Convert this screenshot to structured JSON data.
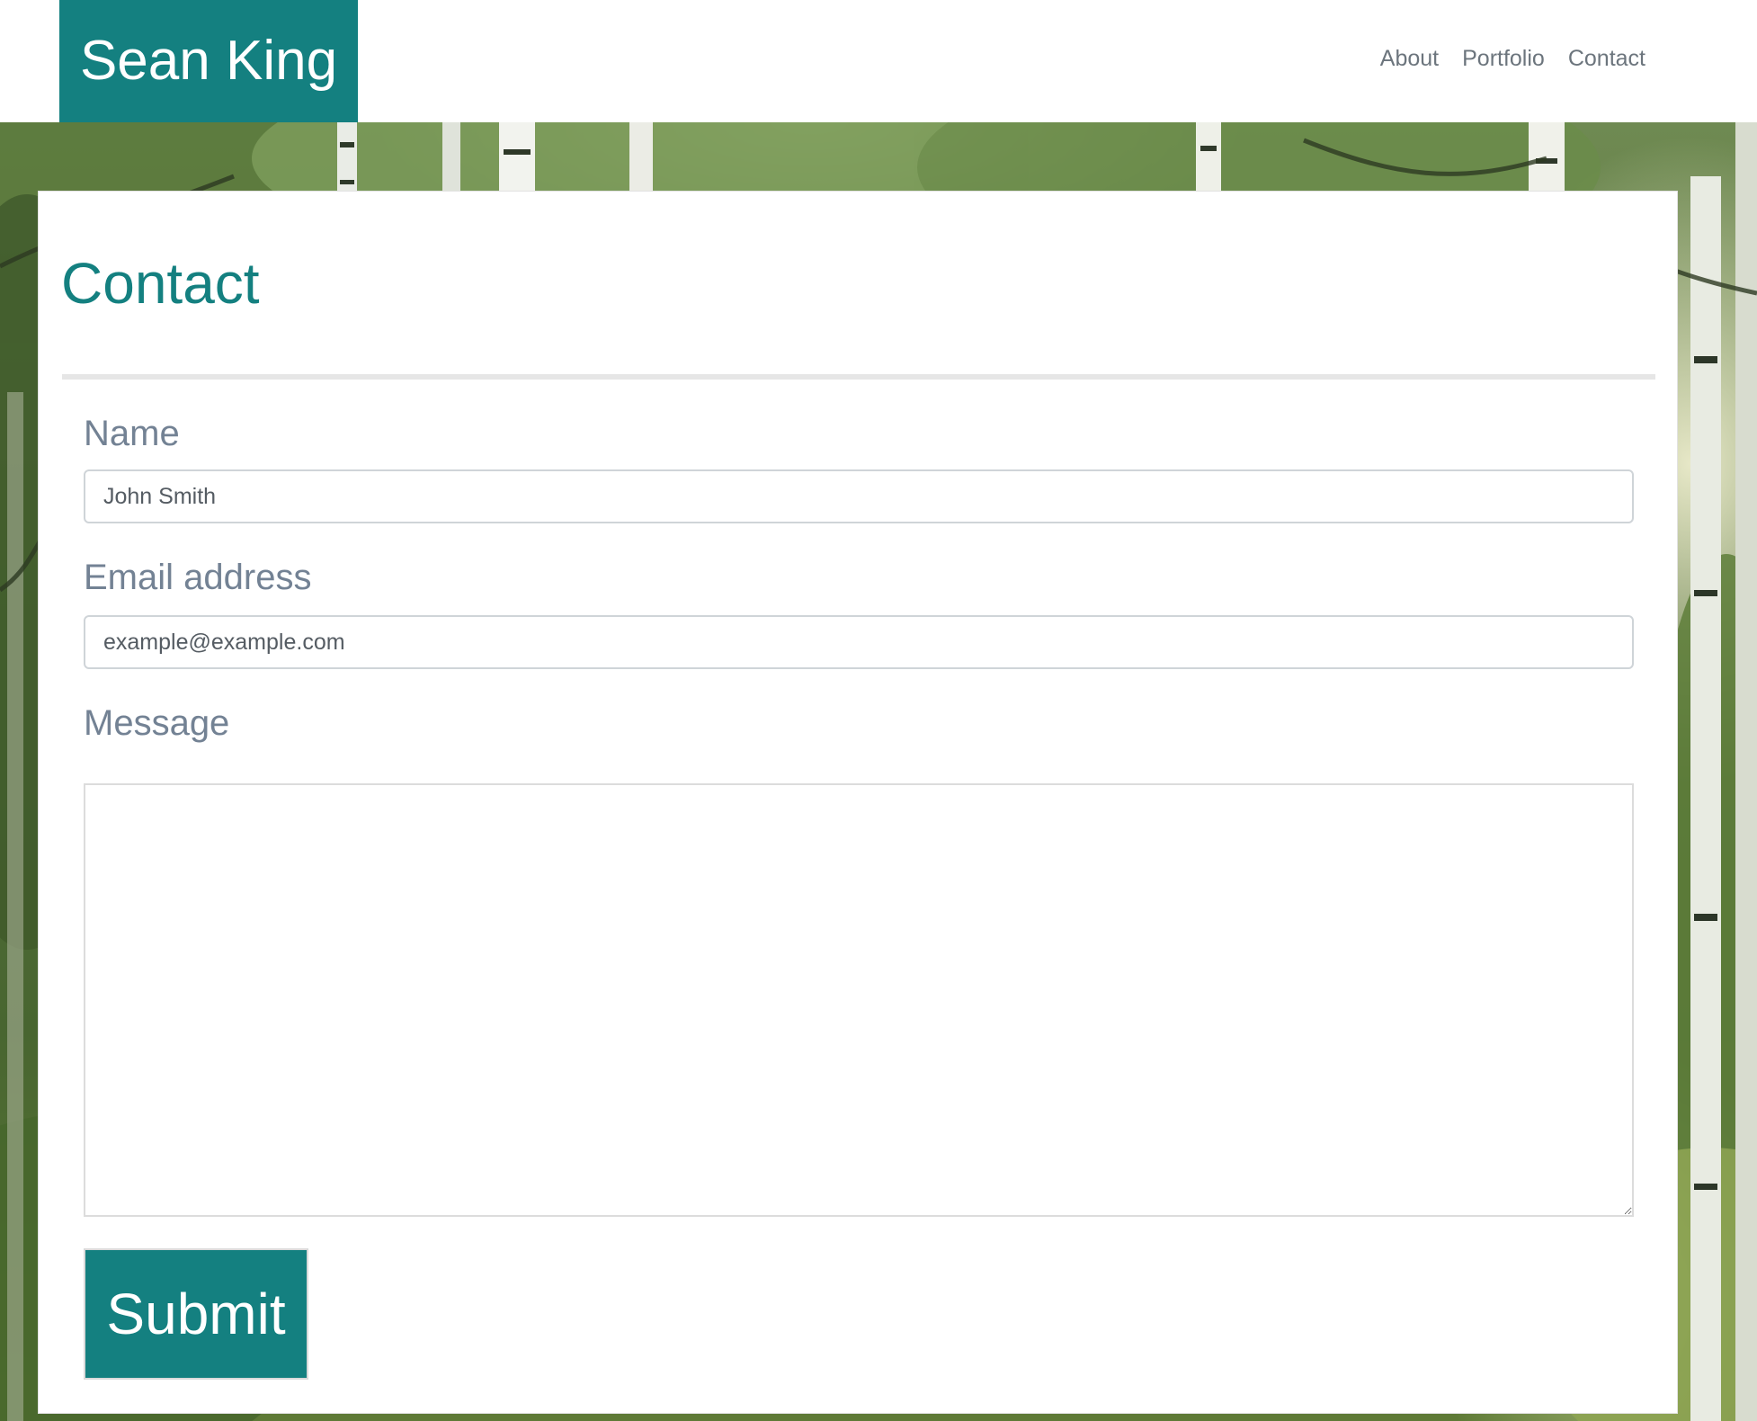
{
  "header": {
    "brand": "Sean King",
    "nav": [
      "About",
      "Portfolio",
      "Contact"
    ]
  },
  "contact": {
    "title": "Contact",
    "name_label": "Name",
    "name_placeholder": "John Smith",
    "email_label": "Email address",
    "email_placeholder": "example@example.com",
    "message_label": "Message",
    "message_value": "",
    "submit_label": "Submit"
  },
  "colors": {
    "brand": "#148080",
    "nav_text": "#6c757d",
    "label_text": "#738294",
    "card_bg": "#ffffff"
  }
}
